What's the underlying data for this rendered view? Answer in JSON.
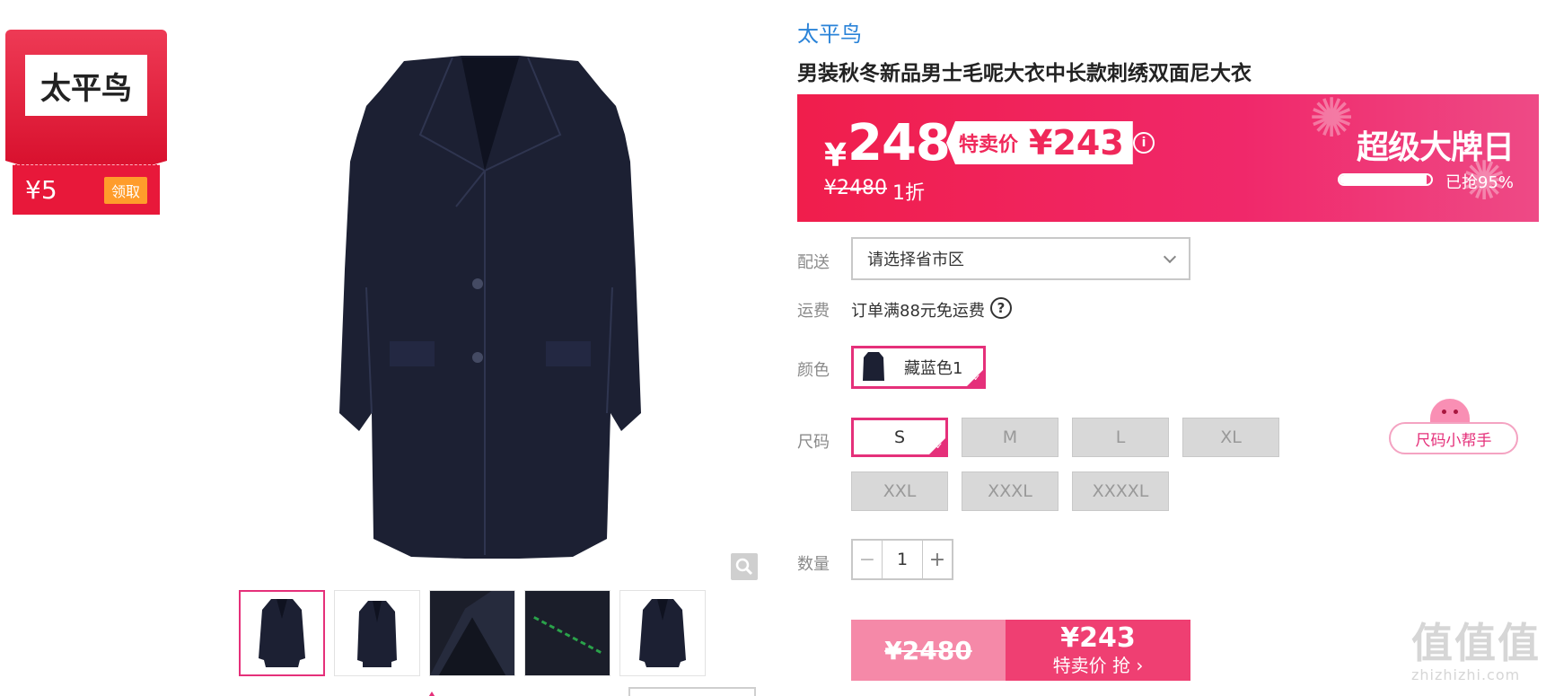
{
  "coupon": {
    "brand": "太平鸟",
    "amount": "¥5",
    "claim_label": "领取"
  },
  "gallery": {
    "zoom_icon": "magnifier-icon",
    "thumbnails": [
      "coat-front",
      "coat-front-2",
      "lapel-detail",
      "embroidery-detail",
      "coat-front-3"
    ]
  },
  "product": {
    "brand": "太平鸟",
    "title": "男装秋冬新品男士毛呢大衣中长款刺绣双面尼大衣"
  },
  "price_banner": {
    "currency": "¥",
    "price": "248",
    "special_label": "特卖价",
    "special_price": "¥243",
    "original_price": "¥2480",
    "discount": "1折",
    "campaign": "超级大牌日",
    "grabbed_text": "已抢95%",
    "grabbed_fraction": 0.95,
    "info_icon": "info-icon"
  },
  "delivery": {
    "label": "配送",
    "placeholder": "请选择省市区"
  },
  "shipping": {
    "label": "运费",
    "text": "订单满88元免运费",
    "help_icon": "question-icon"
  },
  "color": {
    "label": "颜色",
    "options": [
      {
        "name": "藏蓝色1",
        "selected": true
      }
    ]
  },
  "size": {
    "label": "尺码",
    "options": [
      "S",
      "M",
      "L",
      "XL",
      "XXL",
      "XXXL",
      "XXXXL"
    ],
    "selected": "S",
    "helper": "尺码小帮手"
  },
  "quantity": {
    "label": "数量",
    "value": "1",
    "minus": "−",
    "plus": "+"
  },
  "buy_bar": {
    "original": "¥2480",
    "price": "¥243",
    "cta": "特卖价 抢 ›"
  },
  "watermark": {
    "glyphs": "值值值",
    "url": "zhizhizhi.com"
  },
  "colors": {
    "accent": "#e5307a",
    "banner": "#f01e4c",
    "link": "#2a83d8",
    "coupon": "#d9122f"
  }
}
